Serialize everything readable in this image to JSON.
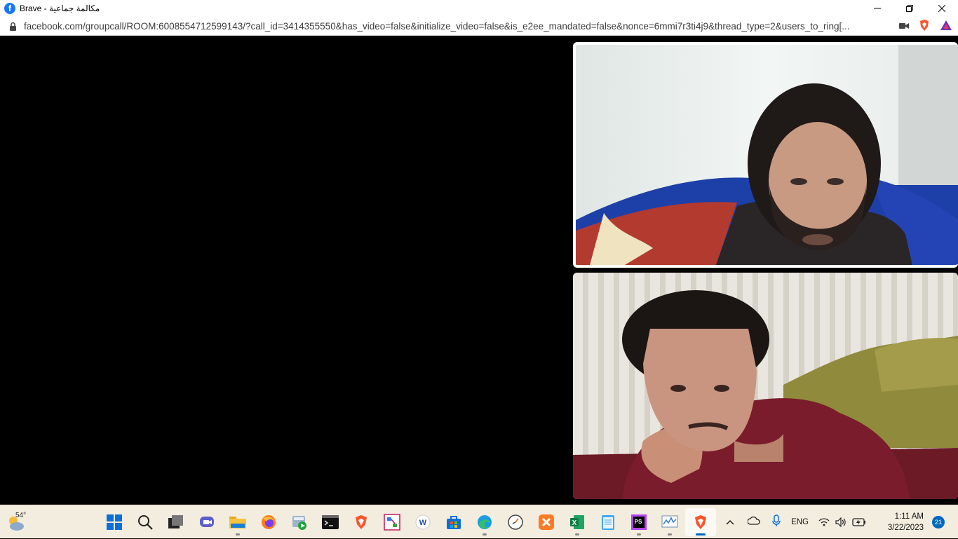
{
  "window": {
    "title": "Brave - مكالمة جماعية",
    "controls": [
      "minimize",
      "maximize",
      "close"
    ]
  },
  "addressbar": {
    "url": "facebook.com/groupcall/ROOM:6008554712599143/?call_id=3414355550&has_video=false&initialize_video=false&is_e2ee_mandated=false&nonce=6mmi7r3ti4j9&thread_type=2&users_to_ring[..."
  },
  "taskbar": {
    "weather": {
      "temp": "54°"
    },
    "apps": [
      {
        "name": "start-button",
        "icon": "windows-icon"
      },
      {
        "name": "search-button",
        "icon": "search-icon"
      },
      {
        "name": "task-view-button",
        "icon": "task-view-icon"
      },
      {
        "name": "teams-chat-button",
        "icon": "chat-icon"
      },
      {
        "name": "file-explorer-button",
        "icon": "folder-icon"
      },
      {
        "name": "firefox-button",
        "icon": "firefox-icon"
      },
      {
        "name": "media-app-button",
        "icon": "media-icon"
      },
      {
        "name": "terminal-button",
        "icon": "terminal-icon"
      },
      {
        "name": "brave-pinned-button",
        "icon": "brave-icon"
      },
      {
        "name": "diagram-app-button",
        "icon": "diagram-icon"
      },
      {
        "name": "word-app-button",
        "icon": "word-icon"
      },
      {
        "name": "microsoft-store-button",
        "icon": "store-icon"
      },
      {
        "name": "edge-button",
        "icon": "edge-icon"
      },
      {
        "name": "clock-app-button",
        "icon": "clock-app-icon"
      },
      {
        "name": "xampp-button",
        "icon": "xampp-icon"
      },
      {
        "name": "excel-button",
        "icon": "excel-icon"
      },
      {
        "name": "notepad-button",
        "icon": "notepad-icon"
      },
      {
        "name": "phpstorm-button",
        "icon": "phpstorm-icon"
      },
      {
        "name": "performance-monitor-button",
        "icon": "monitor-icon"
      },
      {
        "name": "brave-active-button",
        "icon": "brave-icon"
      }
    ],
    "tray": {
      "language": "ENG",
      "time": "1:11 AM",
      "date": "3/22/2023",
      "notifications": "21"
    }
  },
  "colors": {
    "taskbar_bg": "#f3ede0",
    "accent": "#0067c0",
    "facebook_blue": "#1877f2",
    "brave_orange": "#fb542b"
  }
}
